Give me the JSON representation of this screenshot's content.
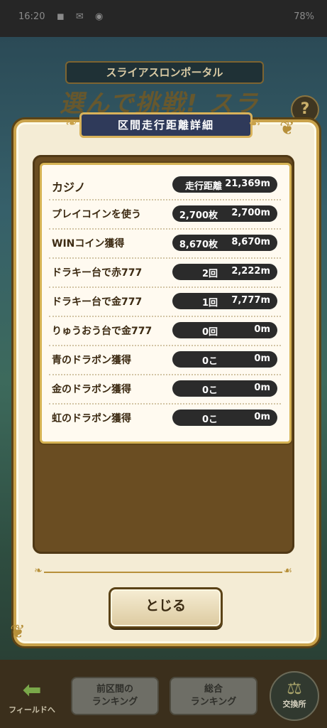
{
  "status_bar": {
    "time": "16:20",
    "icons": "◼ ✉ ◉",
    "battery": "78%"
  },
  "background": {
    "portal_title": "スライアスロンポータル",
    "logo_text": "選んで挑戦! スライアスロン",
    "help": "?"
  },
  "modal": {
    "title": "区間走行距離詳細",
    "header": {
      "label": "カジノ",
      "col1": "走行距離",
      "col2": "21,369m"
    },
    "rows": [
      {
        "label": "プレイコインを使う",
        "col1": "2,700枚",
        "col2": "2,700m"
      },
      {
        "label": "WINコイン獲得",
        "col1": "8,670枚",
        "col2": "8,670m"
      },
      {
        "label": "ドラキー台で赤777",
        "col1": "2回",
        "col2": "2,222m"
      },
      {
        "label": "ドラキー台で金777",
        "col1": "1回",
        "col2": "7,777m"
      },
      {
        "label": "りゅうおう台で金777",
        "col1": "0回",
        "col2": "0m"
      },
      {
        "label": "青のドラポン獲得",
        "col1": "0こ",
        "col2": "0m"
      },
      {
        "label": "金のドラポン獲得",
        "col1": "0こ",
        "col2": "0m"
      },
      {
        "label": "虹のドラポン獲得",
        "col1": "0こ",
        "col2": "0m"
      }
    ],
    "close_label": "とじる"
  },
  "bottom_nav": {
    "field_label": "フィールドへ",
    "prev_ranking": "前区間の\nランキング",
    "total_ranking": "総合\nランキング",
    "exchange": "交換所"
  }
}
